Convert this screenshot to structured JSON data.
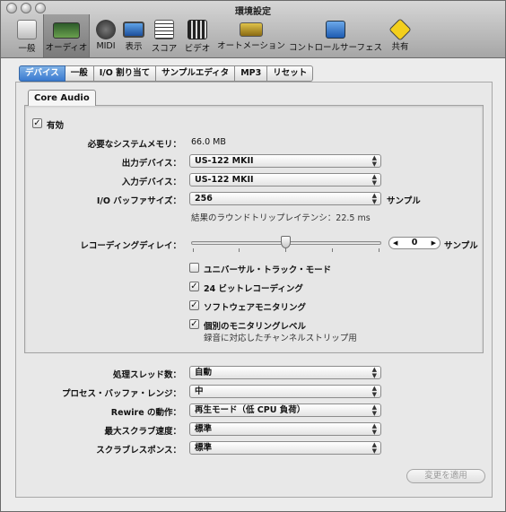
{
  "window": {
    "title": "環境設定"
  },
  "toolbar": {
    "items": [
      {
        "label": "一般",
        "icon": "switch-icon"
      },
      {
        "label": "オーディオ",
        "icon": "audio-waveform-icon",
        "selected": true
      },
      {
        "label": "MIDI",
        "icon": "midi-connector-icon"
      },
      {
        "label": "表示",
        "icon": "display-icon"
      },
      {
        "label": "スコア",
        "icon": "score-icon"
      },
      {
        "label": "ビデオ",
        "icon": "film-icon"
      },
      {
        "label": "オートメーション",
        "icon": "automation-icon"
      },
      {
        "label": "コントロールサーフェス",
        "icon": "control-surface-icon"
      },
      {
        "label": "共有",
        "icon": "share-icon"
      }
    ]
  },
  "tabs": [
    {
      "label": "デバイス",
      "active": true
    },
    {
      "label": "一般"
    },
    {
      "label": "I/O 割り当て"
    },
    {
      "label": "サンプルエディタ"
    },
    {
      "label": "MP3"
    },
    {
      "label": "リセット"
    }
  ],
  "core_audio": {
    "tab_label": "Core Audio",
    "enabled_label": "有効",
    "enabled": true,
    "memory_label": "必要なシステムメモリ：",
    "memory_value": "66.0 MB",
    "output_label": "出力デバイス：",
    "output_value": "US-122 MKII",
    "input_label": "入力デバイス：",
    "input_value": "US-122 MKII",
    "buffer_label": "I/O バッファサイズ：",
    "buffer_value": "256",
    "buffer_unit": "サンプル",
    "latency_text": "結果のラウンドトリップレイテンシ：22.5 ms",
    "delay_label": "レコーディングディレイ：",
    "delay_value": "0",
    "delay_unit": "サンプル",
    "checkboxes": [
      {
        "label": "ユニバーサル・トラック・モード",
        "checked": false
      },
      {
        "label": "24 ビットレコーディング",
        "checked": true
      },
      {
        "label": "ソフトウェアモニタリング",
        "checked": true
      },
      {
        "label": "個別のモニタリングレベル",
        "checked": true
      }
    ],
    "monitoring_note": "録音に対応したチャンネルストリップ用"
  },
  "processing": {
    "threads_label": "処理スレッド数：",
    "threads_value": "自動",
    "buffer_range_label": "プロセス・バッファ・レンジ：",
    "buffer_range_value": "中",
    "rewire_label": "Rewire の動作：",
    "rewire_value": "再生モード（低 CPU 負荷）",
    "scrub_speed_label": "最大スクラブ速度：",
    "scrub_speed_value": "標準",
    "scrub_response_label": "スクラブレスポンス：",
    "scrub_response_value": "標準"
  },
  "apply_label": "変更を適用",
  "check_glyph": "✓",
  "arrows_glyph": "▲▼"
}
